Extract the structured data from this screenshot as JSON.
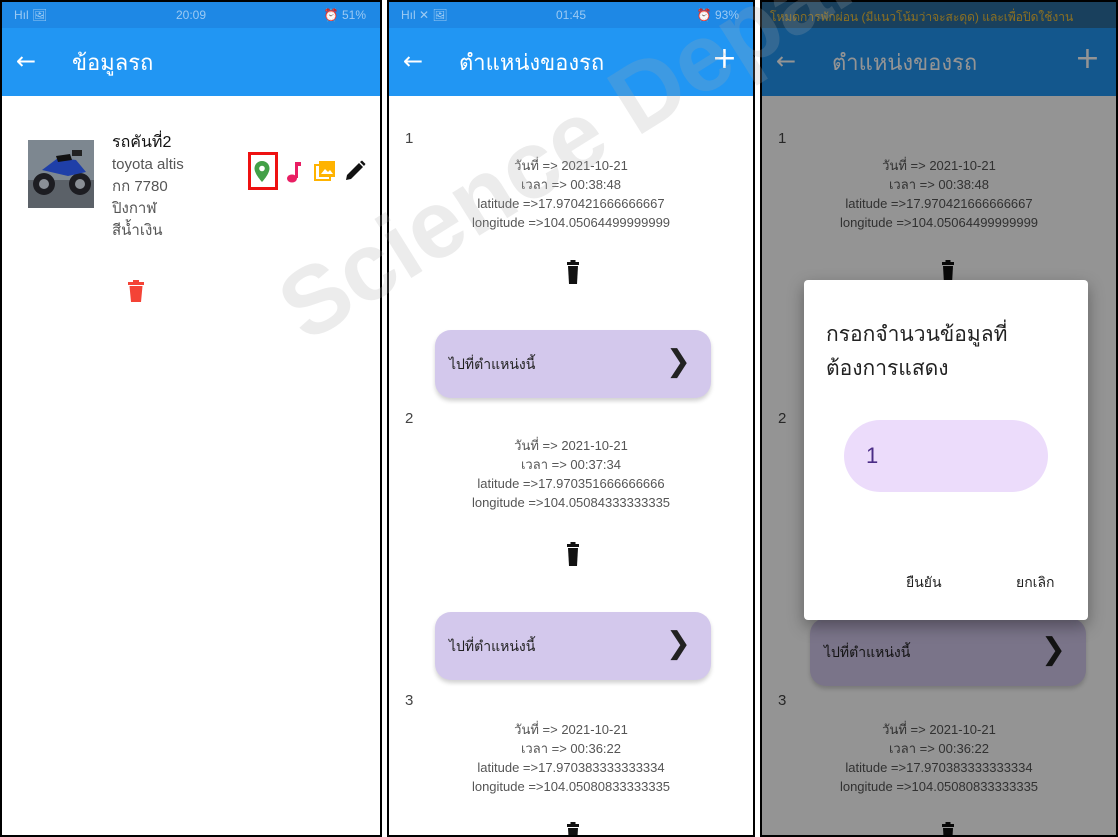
{
  "panel1": {
    "status": {
      "left": "Hıl 🖼",
      "time": "20:09",
      "right": "⏰ 51%"
    },
    "appbar": {
      "back_icon": "arrow-left-icon",
      "title": "ข้อมูลรถ"
    },
    "car": {
      "name": "รถคันที่2",
      "model": "toyota  altis",
      "plate": "กก 7780",
      "category": "ปิงกาฬ",
      "color": "สีน้ำเงิน"
    },
    "icons": [
      "location-pin-icon",
      "music-note-icon",
      "photo-library-icon",
      "edit-pencil-icon",
      "delete-icon"
    ],
    "colors": {
      "pin": "#43a047",
      "music": "#e91e63",
      "photo": "#ffb300",
      "edit": "#111111",
      "delete": "#f44336",
      "highlight": "#ee1111"
    }
  },
  "panel2": {
    "status": {
      "left": "Hıl ✕ 🖼",
      "time": "01:45",
      "right": "⏰ 93%"
    },
    "appbar": {
      "back_icon": "arrow-left-icon",
      "title": "ตำแหน่งของรถ",
      "add_icon": "plus-icon"
    },
    "entries": [
      {
        "num": "1",
        "date": "วันที่ => 2021-10-21",
        "time": "เวลา => 00:38:48",
        "lat": "latitude =>17.970421666666667",
        "lon": "longitude =>104.05064499999999",
        "button": "ไปที่ตำแหน่งนี้"
      },
      {
        "num": "2",
        "date": "วันที่ => 2021-10-21",
        "time": "เวลา => 00:37:34",
        "lat": "latitude =>17.970351666666666",
        "lon": "longitude =>104.05084333333335",
        "button": "ไปที่ตำแหน่งนี้"
      },
      {
        "num": "3",
        "date": "วันที่ => 2021-10-21",
        "time": "เวลา => 00:36:22",
        "lat": "latitude =>17.970383333333334",
        "lon": "longitude =>104.05080833333335"
      }
    ]
  },
  "panel3": {
    "notice": "โหมดการพักผ่อน (มีแนวโน้มว่าจะสะดุด) และเพื่อปิดใช้งาน",
    "appbar": {
      "back_icon": "arrow-left-icon",
      "title": "ตำแหน่งของรถ",
      "add_icon": "plus-icon"
    },
    "entries": [
      {
        "num": "1",
        "date": "วันที่ => 2021-10-21",
        "time": "เวลา => 00:38:48",
        "lat": "latitude =>17.970421666666667",
        "lon": "longitude =>104.05064499999999"
      },
      {
        "num": "2",
        "button": "ไปที่ตำแหน่งนี้"
      },
      {
        "num": "3",
        "date": "วันที่ => 2021-10-21",
        "time": "เวลา => 00:36:22",
        "lat": "latitude =>17.970383333333334",
        "lon": "longitude =>104.05080833333335"
      }
    ],
    "dialog": {
      "title": "กรอกจำนวนข้อมูลที่ต้องการแสดง",
      "input_value": "1",
      "confirm": "ยืนยัน",
      "cancel": "ยกเลิก"
    }
  },
  "watermark": "Science Department Mahasarakham University"
}
